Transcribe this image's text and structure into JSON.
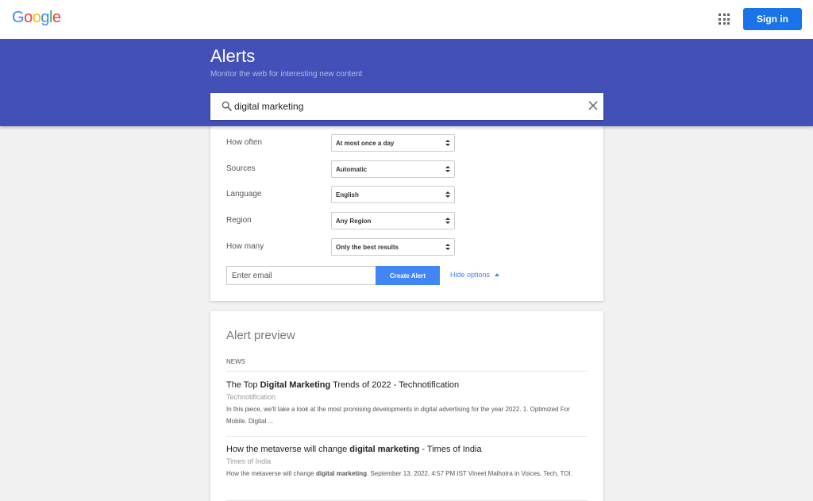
{
  "brand": {
    "logo_letters": [
      "G",
      "o",
      "o",
      "g",
      "l",
      "e"
    ],
    "logo_colors": [
      "#4285f4",
      "#ea4335",
      "#fbbc05",
      "#4285f4",
      "#34a853",
      "#ea4335"
    ]
  },
  "topbar": {
    "signin_label": "Sign in"
  },
  "header": {
    "title": "Alerts",
    "subtitle": "Monitor the web for interesting new content",
    "search_value": "digital marketing",
    "color": "#4350b8"
  },
  "options": [
    {
      "label": "How often",
      "value": "At most once a day"
    },
    {
      "label": "Sources",
      "value": "Automatic"
    },
    {
      "label": "Language",
      "value": "English"
    },
    {
      "label": "Region",
      "value": "Any Region"
    },
    {
      "label": "How many",
      "value": "Only the best results"
    }
  ],
  "form": {
    "email_placeholder": "Enter email",
    "create_label": "Create Alert",
    "hide_label": "Hide options"
  },
  "preview": {
    "heading": "Alert preview",
    "section": "NEWS",
    "items": [
      {
        "title_pre": "The Top ",
        "title_bold": "Digital Marketing",
        "title_post": " Trends of 2022 - Technotification",
        "source": "Technotification",
        "snippet_pre": "In this piece, we'll take a look at the most promising developments in digital advertising for the year 2022. 1. Optimized For Mobile. Digital ...",
        "snippet_bold": "",
        "snippet_post": ""
      },
      {
        "title_pre": "How the metaverse will change ",
        "title_bold": "digital marketing",
        "title_post": " - Times of India",
        "source": "Times of India",
        "snippet_pre": "How the metaverse will change ",
        "snippet_bold": "digital marketing",
        "snippet_post": ". September 13, 2022, 4:57 PM IST Vineet Malhotra in Voices, Tech, TOI."
      }
    ]
  }
}
